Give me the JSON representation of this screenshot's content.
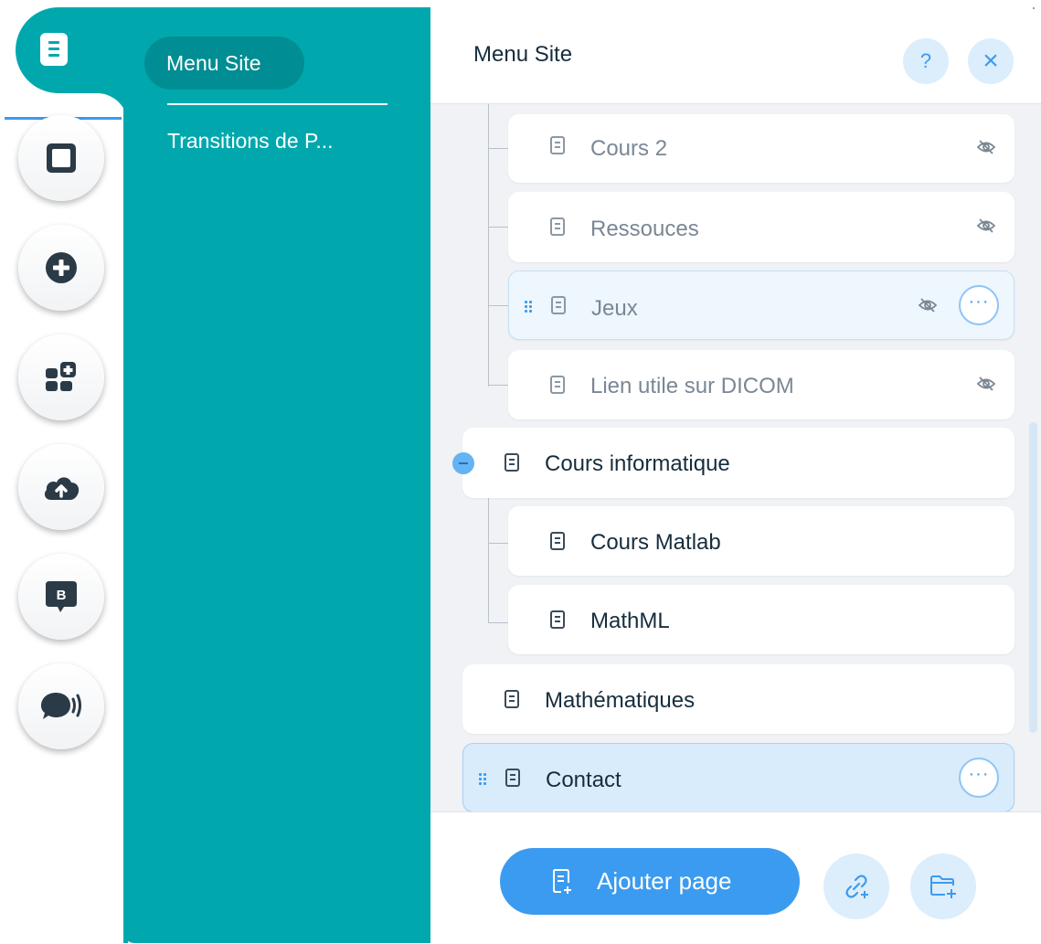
{
  "teal_panel": {
    "active_item": "Menu Site",
    "items": [
      "Transitions de P..."
    ]
  },
  "rail": {
    "icons": [
      "pages-icon",
      "background-icon",
      "add-icon",
      "apps-icon",
      "upload-icon",
      "blog-icon",
      "chat-icon"
    ],
    "blog_letter": "B"
  },
  "panel": {
    "title": "Menu Site",
    "help_label": "?",
    "close_label": "×"
  },
  "tree": {
    "items": [
      {
        "label": "Cours 2",
        "level": 1,
        "hidden": true
      },
      {
        "label": "Ressouces",
        "level": 1,
        "hidden": true
      },
      {
        "label": "Jeux",
        "level": 1,
        "hidden": true,
        "hovered": true
      },
      {
        "label": "Lien utile sur DICOM",
        "level": 1,
        "hidden": true
      },
      {
        "label": "Cours informatique",
        "level": 0,
        "expanded": true
      },
      {
        "label": "Cours Matlab",
        "level": 1
      },
      {
        "label": "MathML",
        "level": 1
      },
      {
        "label": "Mathématiques",
        "level": 0
      },
      {
        "label": "Contact",
        "level": 0,
        "selected": true
      }
    ],
    "more_label": "···"
  },
  "footer": {
    "add_page_label": "Ajouter page"
  },
  "colors": {
    "teal": "#00a8ad",
    "teal_dark": "#008d93",
    "accent_blue": "#3b9bf0",
    "light_blue": "#dcedfc",
    "text_dark": "#162d3d"
  }
}
